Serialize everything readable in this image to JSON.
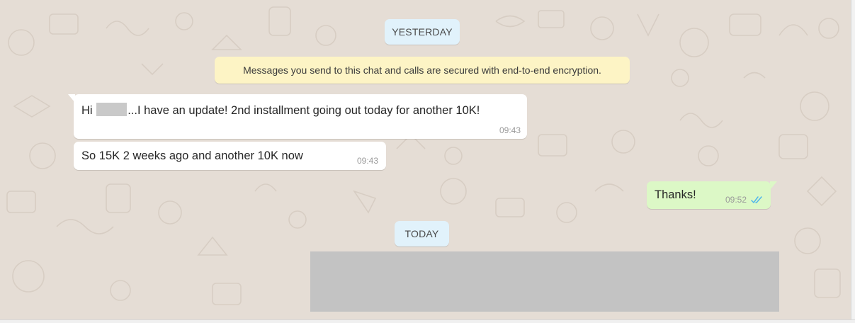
{
  "colors": {
    "wallpaper": "#e5ddd5",
    "incoming_bubble": "#ffffff",
    "outgoing_bubble": "#dcf8c6",
    "date_chip": "#e1f2fb",
    "system_notice": "#fdf4c5",
    "read_ticks": "#4fb6ec"
  },
  "date_dividers": {
    "yesterday": "YESTERDAY",
    "today": "TODAY"
  },
  "system_notice": "Messages you send to this chat and calls are secured with end-to-end encryption.",
  "messages": [
    {
      "direction": "incoming",
      "text_prefix": "Hi",
      "text_suffix": "...I have an update! 2nd installment going out today for another 10K!",
      "time": "09:43"
    },
    {
      "direction": "incoming",
      "text": "So 15K 2 weeks ago and another 10K now",
      "time": "09:43"
    },
    {
      "direction": "outgoing",
      "text": "Thanks!",
      "time": "09:52",
      "status_icon": "double-check-read-icon"
    }
  ],
  "redacted_media": true
}
